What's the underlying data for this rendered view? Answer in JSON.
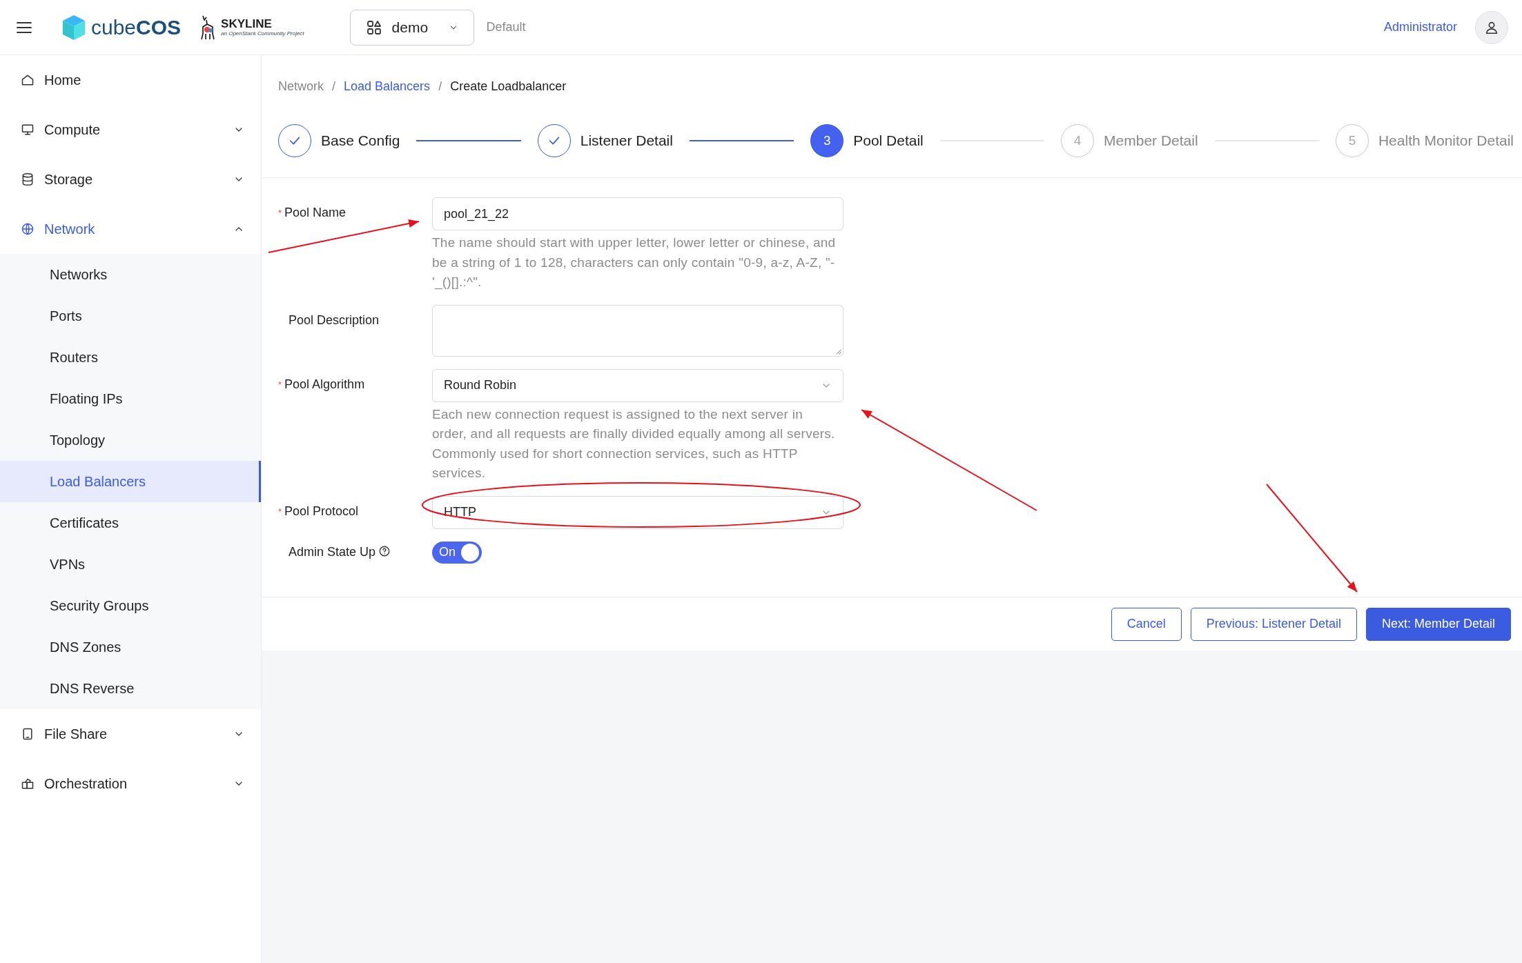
{
  "header": {
    "brand": "cube",
    "brand_bold": "COS",
    "partner": "SKYLINE",
    "partner_tagline": "an OpenStack Community Project",
    "project": "demo",
    "domain": "Default",
    "user": "Administrator"
  },
  "sidebar": {
    "items": [
      {
        "label": "Home",
        "selected": false
      },
      {
        "label": "Compute",
        "expanded": false,
        "selected": false
      },
      {
        "label": "Storage",
        "expanded": false,
        "selected": false
      },
      {
        "label": "Network",
        "expanded": true,
        "selected": true,
        "children": [
          {
            "label": "Networks",
            "selected": false
          },
          {
            "label": "Ports",
            "selected": false
          },
          {
            "label": "Routers",
            "selected": false
          },
          {
            "label": "Floating IPs",
            "selected": false
          },
          {
            "label": "Topology",
            "selected": false
          },
          {
            "label": "Load Balancers",
            "selected": true
          },
          {
            "label": "Certificates",
            "selected": false
          },
          {
            "label": "VPNs",
            "selected": false
          },
          {
            "label": "Security Groups",
            "selected": false
          },
          {
            "label": "DNS Zones",
            "selected": false
          },
          {
            "label": "DNS Reverse",
            "selected": false
          }
        ]
      },
      {
        "label": "File Share",
        "expanded": false,
        "selected": false
      },
      {
        "label": "Orchestration",
        "expanded": false,
        "selected": false
      }
    ]
  },
  "breadcrumb": {
    "separator": "/",
    "items": [
      {
        "label": "Network",
        "kind": "plain"
      },
      {
        "label": "Load Balancers",
        "kind": "link"
      },
      {
        "label": "Create Loadbalancer",
        "kind": "current"
      }
    ]
  },
  "steps": [
    {
      "label": "Base Config",
      "done": true,
      "selected": false
    },
    {
      "label": "Listener Detail",
      "done": true,
      "selected": false
    },
    {
      "number": "3",
      "label": "Pool Detail",
      "done": false,
      "selected": true
    },
    {
      "number": "4",
      "label": "Member Detail",
      "done": false,
      "selected": false
    },
    {
      "number": "5",
      "label": "Health Monitor Detail",
      "done": false,
      "selected": false
    }
  ],
  "form": [
    {
      "kind": "input",
      "label": "Pool Name",
      "required_mark": "*",
      "value": "pool_21_22",
      "help": "The name should start with upper letter, lower letter or chinese, and be a string of 1 to 128, characters can only contain \"0-9, a-z, A-Z, \"-'_()[].:^\"."
    },
    {
      "kind": "textarea",
      "label": "Pool Description"
    },
    {
      "kind": "select",
      "label": "Pool Algorithm",
      "required_mark": "*",
      "value": "Round Robin",
      "help": "Each new connection request is assigned to the next server in order, and all requests are finally divided equally among all servers. Commonly used for short connection services, such as HTTP services."
    },
    {
      "kind": "select",
      "label": "Pool Protocol",
      "required_mark": "*",
      "value": "HTTP"
    },
    {
      "kind": "switch",
      "label": "Admin State Up",
      "info": true,
      "on": true,
      "text": "On"
    }
  ],
  "buttons": [
    {
      "label": "Cancel",
      "kind": "default"
    },
    {
      "label": "Previous: Listener Detail",
      "kind": "default"
    },
    {
      "label": "Next: Member Detail",
      "kind": "primary"
    }
  ]
}
